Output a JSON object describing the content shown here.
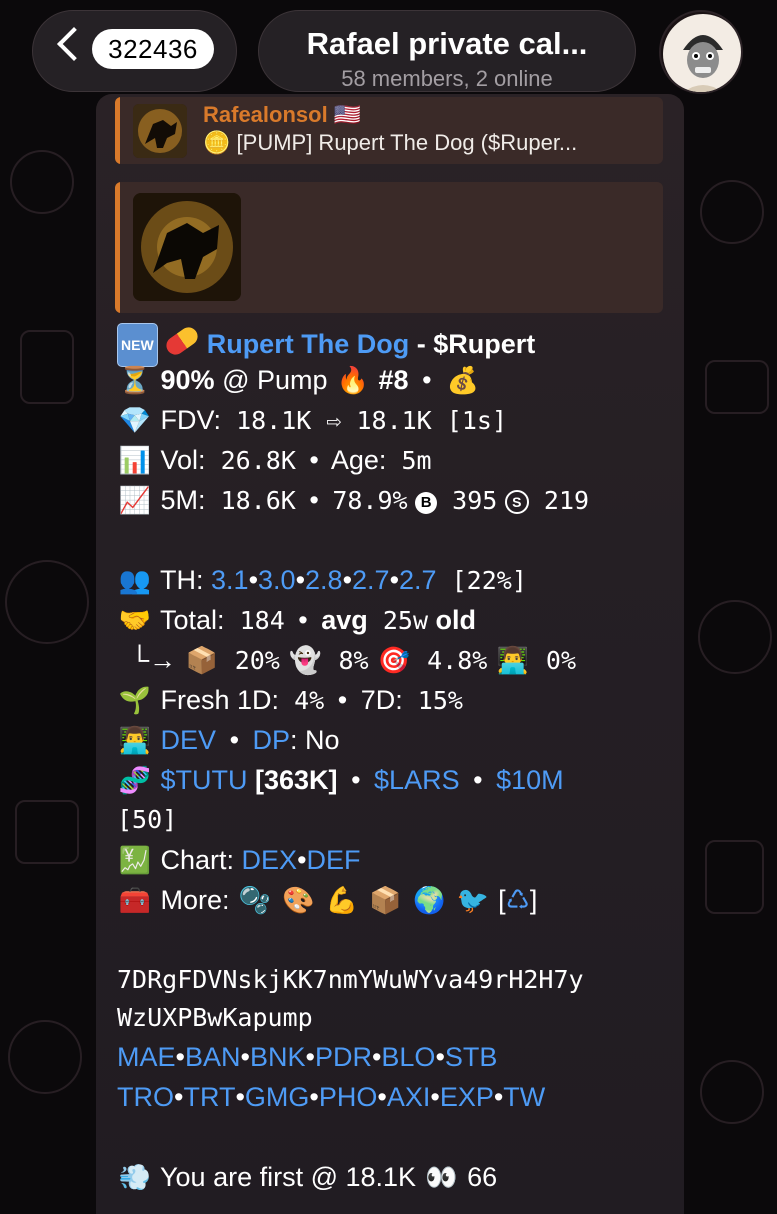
{
  "header": {
    "back_count": "322436",
    "title": "Rafael private cal...",
    "subtitle": "58 members, 2 online"
  },
  "reply": {
    "name": "Rafealonsol",
    "flag": "🇺🇸",
    "coin_icon": "🪙",
    "text": "[PUMP] Rupert The Dog ($Ruper..."
  },
  "message": {
    "title_link": "Rupert The Dog",
    "title_rest": " - $Rupert",
    "progress": "90%",
    "pump_text": " @ Pump ",
    "rank": "#8",
    "fdv_label": "FDV:",
    "fdv_value": " 18.1K ⇨ 18.1K [1s]",
    "vol_label": "Vol:",
    "vol_value": " 26.8K",
    "age_label": "Age:",
    "age_value": " 5m",
    "fivem_label": "5M:",
    "fivem_value": " 18.6K",
    "fivem_pct": " 78.9%",
    "buys_icon": "B",
    "buys": " 395",
    "sells_icon": "S",
    "sells": " 219",
    "th_label": "TH: ",
    "th_values": [
      "3.1",
      "3.0",
      "2.8",
      "2.7",
      "2.7"
    ],
    "th_pct": " [22%]",
    "total_label": "Total:",
    "total_value": " 184",
    "avg_label": "avg",
    "avg_value": " 25w",
    "old_label": " old",
    "dist_arrow": "└→",
    "dist": [
      " 20%",
      " 8%",
      " 4.8%",
      " 0%"
    ],
    "fresh1d_label": "Fresh 1D:",
    "fresh1d_value": " 4%",
    "fresh7d_label": "7D:",
    "fresh7d_value": " 15%",
    "dev_link": "DEV",
    "dp_link": "DP",
    "dp_value": ": No",
    "tutu_link": "$TUTU",
    "tutu_val": " [363K]",
    "lars_link": "$LARS",
    "tenm_link": "$10M",
    "fifty": "[50]",
    "chart_label": "Chart: ",
    "dex_link": "DEX",
    "def_link": "DEF",
    "more_label": "More:",
    "address_1": "7DRgFDVNskjKK7nmYWuWYva49rH2H7y",
    "address_2": "WzUXPBwKapump",
    "links_row1": [
      "MAE",
      "BAN",
      "BNK",
      "PDR",
      "BLO",
      "STB"
    ],
    "links_row2": [
      "TRO",
      "TRT",
      "GMG",
      "PHO",
      "AXI",
      "EXP",
      "TW"
    ],
    "first_text": " You are first @ 18.1K ",
    "first_count": " 66"
  },
  "colors": {
    "link": "#4e9bf5",
    "reply_name": "#d97a2b",
    "bubble": "#251f24"
  }
}
